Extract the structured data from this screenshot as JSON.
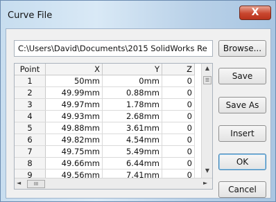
{
  "window": {
    "title": "Curve File",
    "close_glyph": "X"
  },
  "path": {
    "value": "C:\\Users\\David\\Documents\\2015 SolidWorks Re"
  },
  "table": {
    "columns": [
      "Point",
      "X",
      "Y",
      "Z"
    ],
    "rows": [
      [
        "1",
        "50mm",
        "0mm",
        "0"
      ],
      [
        "2",
        "49.99mm",
        "0.88mm",
        "0"
      ],
      [
        "3",
        "49.97mm",
        "1.78mm",
        "0"
      ],
      [
        "4",
        "49.93mm",
        "2.68mm",
        "0"
      ],
      [
        "5",
        "49.88mm",
        "3.61mm",
        "0"
      ],
      [
        "6",
        "49.82mm",
        "4.54mm",
        "0"
      ],
      [
        "7",
        "49.75mm",
        "5.49mm",
        "0"
      ],
      [
        "8",
        "49.66mm",
        "6.44mm",
        "0"
      ],
      [
        "9",
        "49.56mm",
        "7.41mm",
        "0"
      ]
    ]
  },
  "scroll": {
    "up": "▲",
    "down": "▼",
    "left": "◄",
    "right": "►",
    "v_grip": "☰",
    "h_grip": "III"
  },
  "buttons": {
    "browse": "Browse...",
    "save": "Save",
    "save_as": "Save As",
    "insert": "Insert",
    "ok": "OK",
    "cancel": "Cancel"
  }
}
